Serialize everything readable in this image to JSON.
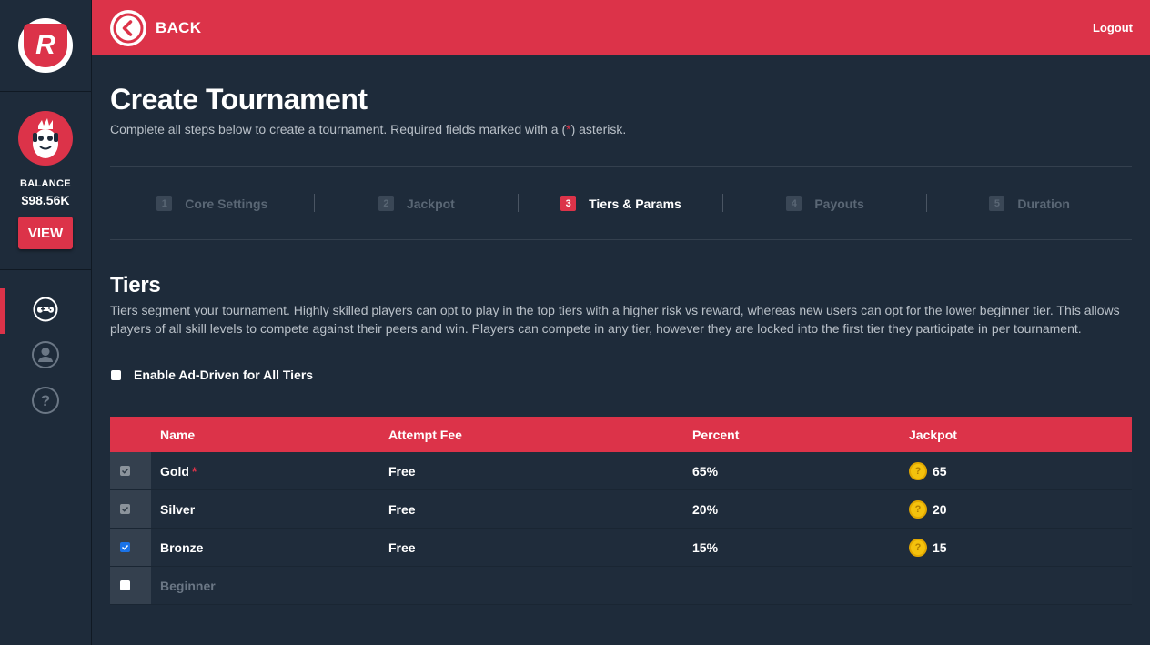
{
  "sidebar": {
    "logo_text": "R",
    "balance_label": "BALANCE",
    "balance_value": "$98.56K",
    "view_label": "VIEW",
    "nav": [
      {
        "icon": "gamepad-icon",
        "active": true
      },
      {
        "icon": "user-icon",
        "active": false
      },
      {
        "icon": "help-icon",
        "active": false
      }
    ]
  },
  "topbar": {
    "back_label": "BACK",
    "logout_label": "Logout"
  },
  "page": {
    "title": "Create Tournament",
    "subtitle_before": "Complete all steps below to create a tournament. Required fields marked with a (",
    "subtitle_star": "*",
    "subtitle_after": ") asterisk."
  },
  "steps": [
    {
      "num": "1",
      "label": "Core Settings",
      "active": false
    },
    {
      "num": "2",
      "label": "Jackpot",
      "active": false
    },
    {
      "num": "3",
      "label": "Tiers & Params",
      "active": true
    },
    {
      "num": "4",
      "label": "Payouts",
      "active": false
    },
    {
      "num": "5",
      "label": "Duration",
      "active": false
    }
  ],
  "tiers": {
    "title": "Tiers",
    "description": "Tiers segment your tournament. Highly skilled players can opt to play in the top tiers with a higher risk vs reward, whereas new users can opt for the lower beginner tier. This allows players of all skill levels to compete against their peers and win. Players can compete in any tier, however they are locked into the first tier they participate in per tournament.",
    "ad_driven_label": "Enable Ad-Driven for All Tiers",
    "ad_driven_checked": false
  },
  "table": {
    "headers": {
      "name": "Name",
      "fee": "Attempt Fee",
      "percent": "Percent",
      "jackpot": "Jackpot"
    },
    "rows": [
      {
        "name": "Gold",
        "required": "*",
        "fee": "Free",
        "percent": "65%",
        "jackpot": "65",
        "state": "checked-disabled"
      },
      {
        "name": "Silver",
        "required": "",
        "fee": "Free",
        "percent": "20%",
        "jackpot": "20",
        "state": "checked-disabled"
      },
      {
        "name": "Bronze",
        "required": "",
        "fee": "Free",
        "percent": "15%",
        "jackpot": "15",
        "state": "checked"
      },
      {
        "name": "Beginner",
        "required": "",
        "fee": "",
        "percent": "",
        "jackpot": "",
        "state": "unchecked"
      }
    ]
  },
  "colors": {
    "accent": "#dc3349",
    "background": "#1e2b3a",
    "coin": "#f4c20d"
  }
}
